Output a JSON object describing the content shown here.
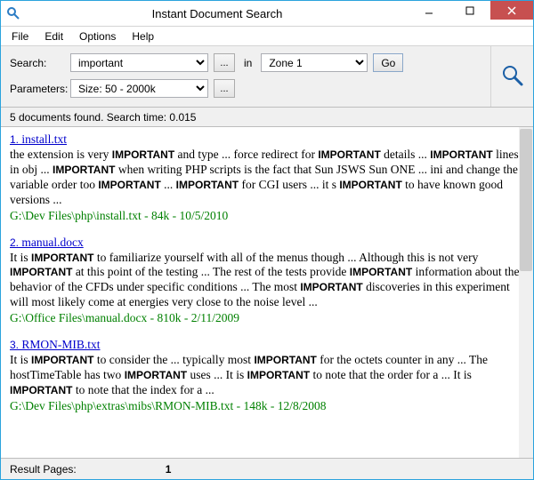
{
  "window": {
    "title": "Instant Document Search"
  },
  "menu": {
    "file": "File",
    "edit": "Edit",
    "options": "Options",
    "help": "Help"
  },
  "toolbar": {
    "search_label": "Search:",
    "search_value": "important",
    "browse": "...",
    "in": "in",
    "zone_value": "Zone 1",
    "go": "Go",
    "params_label": "Parameters:",
    "params_value": "Size: 50 - 2000k"
  },
  "status": {
    "found": "5 documents found. Search time: 0.015"
  },
  "results": [
    {
      "num": "1.",
      "title": "install.txt",
      "snippet": "the extension is very <b>IMPORTANT</b> and type ... force redirect for <b>IMPORTANT</b> details ... <b>IMPORTANT</b> lines in obj ... <b>IMPORTANT</b> when writing PHP scripts is the fact that Sun JSWS Sun ONE ... ini and change the variable order too <b>IMPORTANT</b> ... <b>IMPORTANT</b> for CGI users ... it s <b>IMPORTANT</b> to have known good versions ...",
      "path": "G:\\Dev Files\\php\\install.txt - 84k - 10/5/2010"
    },
    {
      "num": "2.",
      "title": "manual.docx",
      "snippet": "It is <b>IMPORTANT</b> to familiarize yourself with all of the menus though ... Although this is not very <b>IMPORTANT</b> at this point of the testing ... The rest of the tests provide <b>IMPORTANT</b> information about the behavior of the CFDs under specific conditions ... The most <b>IMPORTANT</b> discoveries in this experiment will most likely come at energies very close to the noise level ...",
      "path": "G:\\Office Files\\manual.docx - 810k - 2/11/2009"
    },
    {
      "num": "3.",
      "title": "RMON-MIB.txt",
      "snippet": "It is <b>IMPORTANT</b> to consider the ... typically most <b>IMPORTANT</b> for the octets counter in any ... The hostTimeTable has two <b>IMPORTANT</b> uses ... It is <b>IMPORTANT</b> to note that the order for a ... It is <b>IMPORTANT</b> to note that the index for a ...",
      "path": "G:\\Dev Files\\php\\extras\\mibs\\RMON-MIB.txt - 148k - 12/8/2008"
    }
  ],
  "footer": {
    "pages_label": "Result Pages:",
    "page": "1"
  }
}
